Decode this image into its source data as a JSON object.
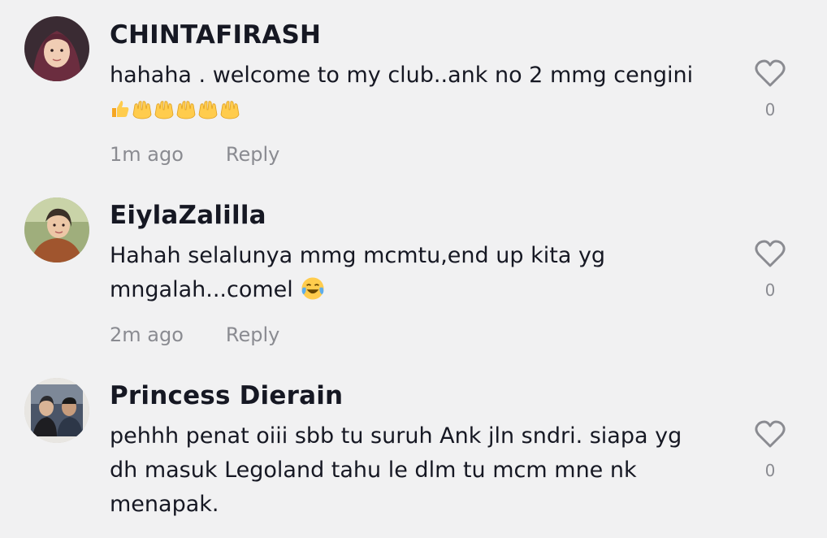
{
  "comments": [
    {
      "username": "CHINTAFIRASH",
      "text": "hahaha . welcome to my club..ank no 2 mmg cengini",
      "emojis": [
        "thumbs-up",
        "raised-hands",
        "raised-hands",
        "raised-hands",
        "raised-hands",
        "raised-hands"
      ],
      "time": "1m ago",
      "reply_label": "Reply",
      "like_count": "0"
    },
    {
      "username": "EiylaZalilla",
      "text": "Hahah selalunya mmg mcmtu,end up kita yg mngalah...comel",
      "emojis": [
        "tears-of-joy"
      ],
      "time": "2m ago",
      "reply_label": "Reply",
      "like_count": "0"
    },
    {
      "username": "Princess Dierain",
      "text": "pehhh penat oiii sbb tu suruh Ank jln sndri. siapa yg dh masuk Legoland tahu le dlm tu mcm mne nk menapak.",
      "emojis": [],
      "time": "",
      "reply_label": "",
      "like_count": "0"
    }
  ]
}
